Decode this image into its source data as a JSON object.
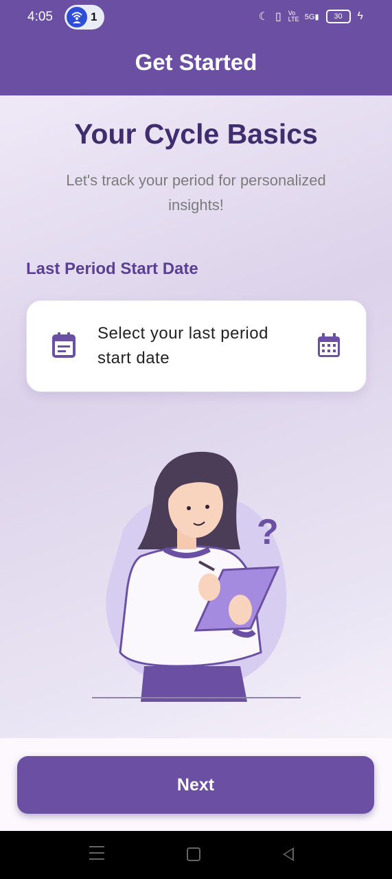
{
  "status_bar": {
    "time": "4:05",
    "notification_count": "1",
    "battery": "30",
    "network": "5G",
    "volte": "Vo LTE"
  },
  "app_bar": {
    "title": "Get Started"
  },
  "main": {
    "heading": "Your Cycle Basics",
    "subtitle": "Let's track your period for personalized insights!",
    "section_label": "Last Period Start Date",
    "date_picker": {
      "placeholder": "Select your last period start date",
      "left_icon": "event-note-icon",
      "right_icon": "calendar-month-icon"
    },
    "illustration": {
      "question_mark": "?"
    }
  },
  "footer": {
    "next_label": "Next"
  },
  "colors": {
    "primary": "#6a4fa3",
    "heading": "#3f2d6d",
    "label": "#5a3f95"
  }
}
